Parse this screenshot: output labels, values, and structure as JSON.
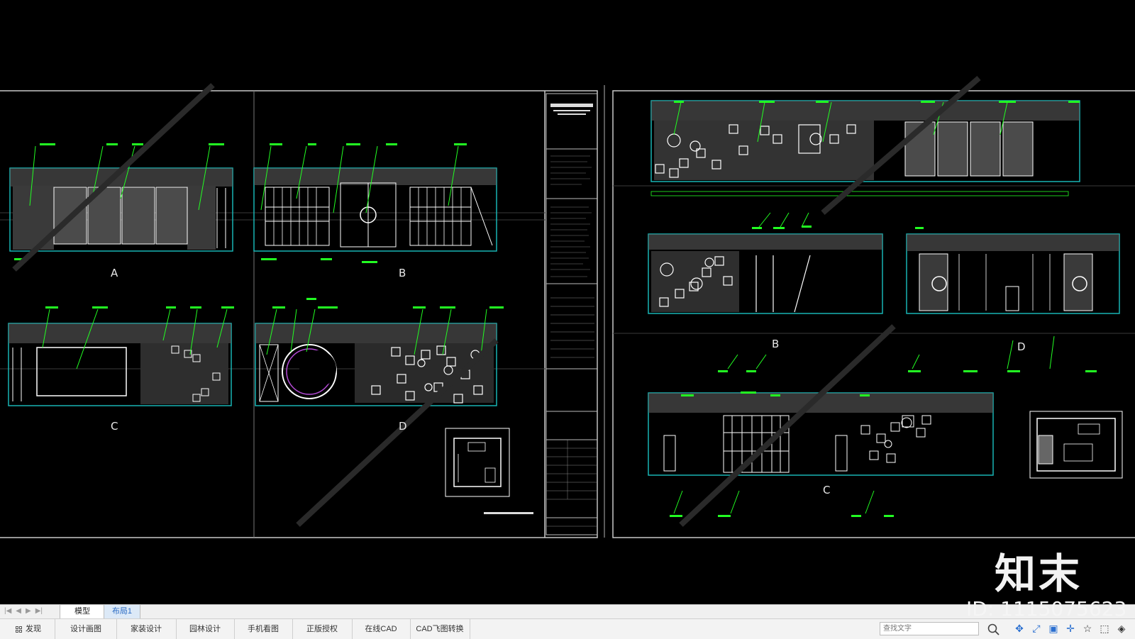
{
  "drawing": {
    "left_sheet_labels": [
      "A",
      "B",
      "C",
      "D"
    ],
    "right_sheet_labels": [
      "B",
      "D",
      "C"
    ],
    "colors": {
      "background": "#000000",
      "frame": "#c8c8c8",
      "wall": "#19b4b4",
      "line": "#ffffff",
      "annotation": "#22ff22",
      "hatch": "#6a6a6a",
      "accent": "#b44bd6"
    }
  },
  "watermark": {
    "logo": "知末",
    "id_text": "ID: 1115075623"
  },
  "tabs": {
    "model": "模型",
    "layout1": "布局1"
  },
  "toolbar": {
    "items": [
      "发现",
      "设计画图",
      "家装设计",
      "园林设计",
      "手机看图",
      "正版授权",
      "在线CAD",
      "CAD飞图转换"
    ],
    "search_placeholder": "查找文字",
    "icons": [
      "search-icon",
      "pan-icon",
      "zoom-icon",
      "window-icon",
      "crosshair-icon",
      "star-icon",
      "box-icon",
      "layers-icon"
    ]
  }
}
